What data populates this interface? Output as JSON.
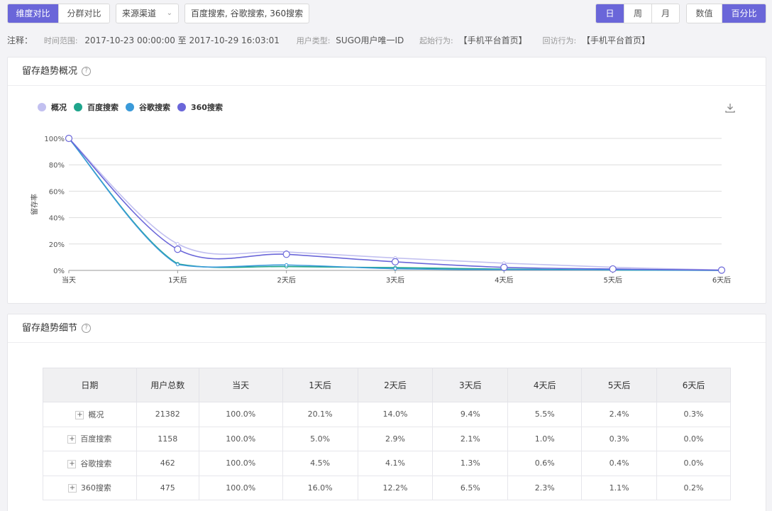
{
  "toolbar": {
    "compare_tabs": [
      "维度对比",
      "分群对比"
    ],
    "source_select": "来源渠道",
    "channels_select": "百度搜索, 谷歌搜索, 360搜索",
    "period_tabs": [
      "日",
      "周",
      "月"
    ],
    "mode_tabs": [
      "数值",
      "百分比"
    ]
  },
  "note": {
    "title": "注释：",
    "range_label": "时间范围:",
    "range_value": "2017-10-23 00:00:00 至 2017-10-29 16:03:01",
    "user_type_label": "用户类型:",
    "user_type_value": "SUGO用户唯一ID",
    "start_label": "起始行为:",
    "start_value": "【手机平台首页】",
    "return_label": "回访行为:",
    "return_value": "【手机平台首页】"
  },
  "overview_card": {
    "title": "留存趋势概况",
    "help_icon": "question-circle-icon",
    "download_icon": "download-icon"
  },
  "detail_card": {
    "title": "留存趋势细节",
    "help_icon": "question-circle-icon"
  },
  "colors": {
    "accent": "#6a66d9",
    "overview": "#c2c0f0",
    "baidu": "#1fa58c",
    "google": "#3a9ad9",
    "s360": "#6a66d9"
  },
  "chart_data": {
    "type": "line",
    "ylabel": "留存率",
    "xlabel": "",
    "categories": [
      "当天",
      "1天后",
      "2天后",
      "3天后",
      "4天后",
      "5天后",
      "6天后"
    ],
    "y_ticks": [
      "100%",
      "80%",
      "60%",
      "40%",
      "20%",
      "0%"
    ],
    "ylim": [
      0,
      100
    ],
    "legend_position": "top-left",
    "grid": true,
    "series": [
      {
        "name": "概况",
        "color": "#c2c0f0",
        "values": [
          100,
          20.1,
          14.0,
          9.4,
          5.5,
          2.4,
          0.3
        ]
      },
      {
        "name": "百度搜索",
        "color": "#1fa58c",
        "values": [
          100,
          5.0,
          2.9,
          2.1,
          1.0,
          0.3,
          0.0
        ]
      },
      {
        "name": "谷歌搜索",
        "color": "#3a9ad9",
        "values": [
          100,
          4.5,
          4.1,
          1.3,
          0.6,
          0.4,
          0.0
        ]
      },
      {
        "name": "360搜索",
        "color": "#6a66d9",
        "values": [
          100,
          16.0,
          12.2,
          6.5,
          2.3,
          1.1,
          0.2
        ]
      }
    ]
  },
  "table": {
    "headers": [
      "日期",
      "用户总数",
      "当天",
      "1天后",
      "2天后",
      "3天后",
      "4天后",
      "5天后",
      "6天后"
    ],
    "rows": [
      [
        "概况",
        "21382",
        "100.0%",
        "20.1%",
        "14.0%",
        "9.4%",
        "5.5%",
        "2.4%",
        "0.3%"
      ],
      [
        "百度搜索",
        "1158",
        "100.0%",
        "5.0%",
        "2.9%",
        "2.1%",
        "1.0%",
        "0.3%",
        "0.0%"
      ],
      [
        "谷歌搜索",
        "462",
        "100.0%",
        "4.5%",
        "4.1%",
        "1.3%",
        "0.6%",
        "0.4%",
        "0.0%"
      ],
      [
        "360搜索",
        "475",
        "100.0%",
        "16.0%",
        "12.2%",
        "6.5%",
        "2.3%",
        "1.1%",
        "0.2%"
      ]
    ]
  }
}
